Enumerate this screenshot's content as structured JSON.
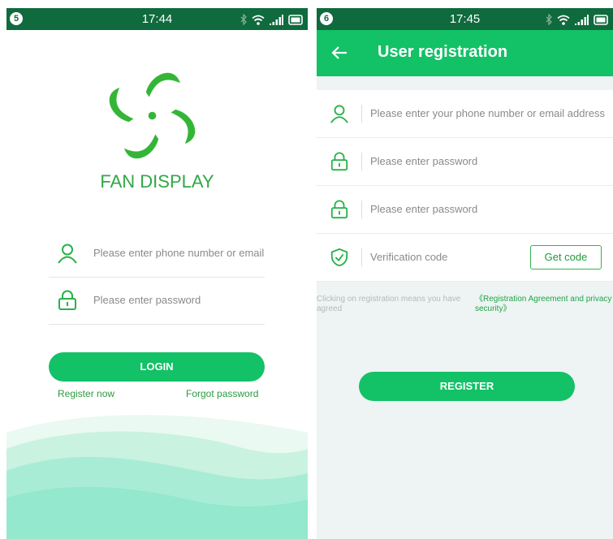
{
  "login": {
    "status": {
      "badge": "5",
      "time": "17:44"
    },
    "app_title": "FAN DISPLAY",
    "phone_placeholder": "Please enter phone number or email b",
    "password_placeholder": "Please enter password",
    "login_label": "LOGIN",
    "register_link": "Register now",
    "forgot_link": "Forgot password"
  },
  "registration": {
    "status": {
      "badge": "6",
      "time": "17:45"
    },
    "title": "User registration",
    "phone_placeholder": "Please enter your phone number or email address",
    "password_placeholder": "Please enter password",
    "confirm_placeholder": "Please enter password",
    "code_placeholder": "Verification code",
    "get_code_label": "Get code",
    "agreement_text": "Clicking on registration means you have agreed",
    "agreement_link": "《Registration Agreement and privacy security》",
    "register_label": "REGISTER"
  },
  "colors": {
    "primary": "#13c166",
    "status_bar": "#0f6a3e",
    "logo": "#35b537",
    "title": "#2fa845"
  }
}
